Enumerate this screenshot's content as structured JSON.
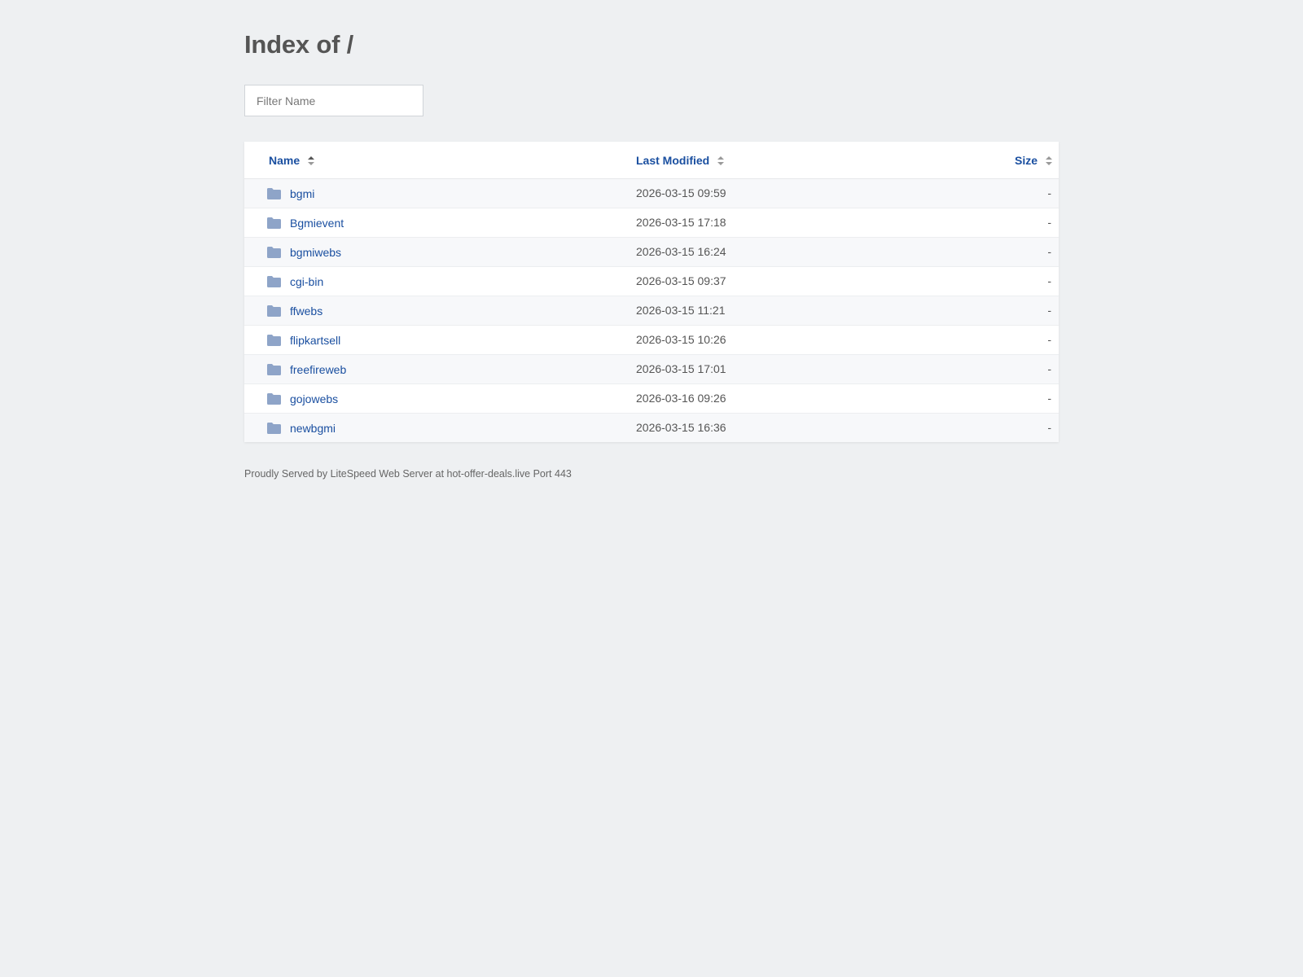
{
  "header": {
    "title": "Index of /"
  },
  "filter": {
    "placeholder": "Filter Name"
  },
  "table": {
    "columns": {
      "name": "Name",
      "modified": "Last Modified",
      "size": "Size"
    },
    "rows": [
      {
        "name": "bgmi",
        "modified": "2026-03-15 09:59",
        "size": "-"
      },
      {
        "name": "Bgmievent",
        "modified": "2026-03-15 17:18",
        "size": "-"
      },
      {
        "name": "bgmiwebs",
        "modified": "2026-03-15 16:24",
        "size": "-"
      },
      {
        "name": "cgi-bin",
        "modified": "2026-03-15 09:37",
        "size": "-"
      },
      {
        "name": "ffwebs",
        "modified": "2026-03-15 11:21",
        "size": "-"
      },
      {
        "name": "flipkartsell",
        "modified": "2026-03-15 10:26",
        "size": "-"
      },
      {
        "name": "freefireweb",
        "modified": "2026-03-15 17:01",
        "size": "-"
      },
      {
        "name": "gojowebs",
        "modified": "2026-03-16 09:26",
        "size": "-"
      },
      {
        "name": "newbgmi",
        "modified": "2026-03-15 16:36",
        "size": "-"
      }
    ]
  },
  "footer": {
    "text": "Proudly Served by LiteSpeed Web Server at hot-offer-deals.live Port 443"
  },
  "colors": {
    "link": "#1a4fa0",
    "folder_icon": "#8ea4c8",
    "background": "#eef0f2"
  },
  "icons": {
    "row_icon": "folder-icon",
    "sort_icon": "sort-icon"
  }
}
